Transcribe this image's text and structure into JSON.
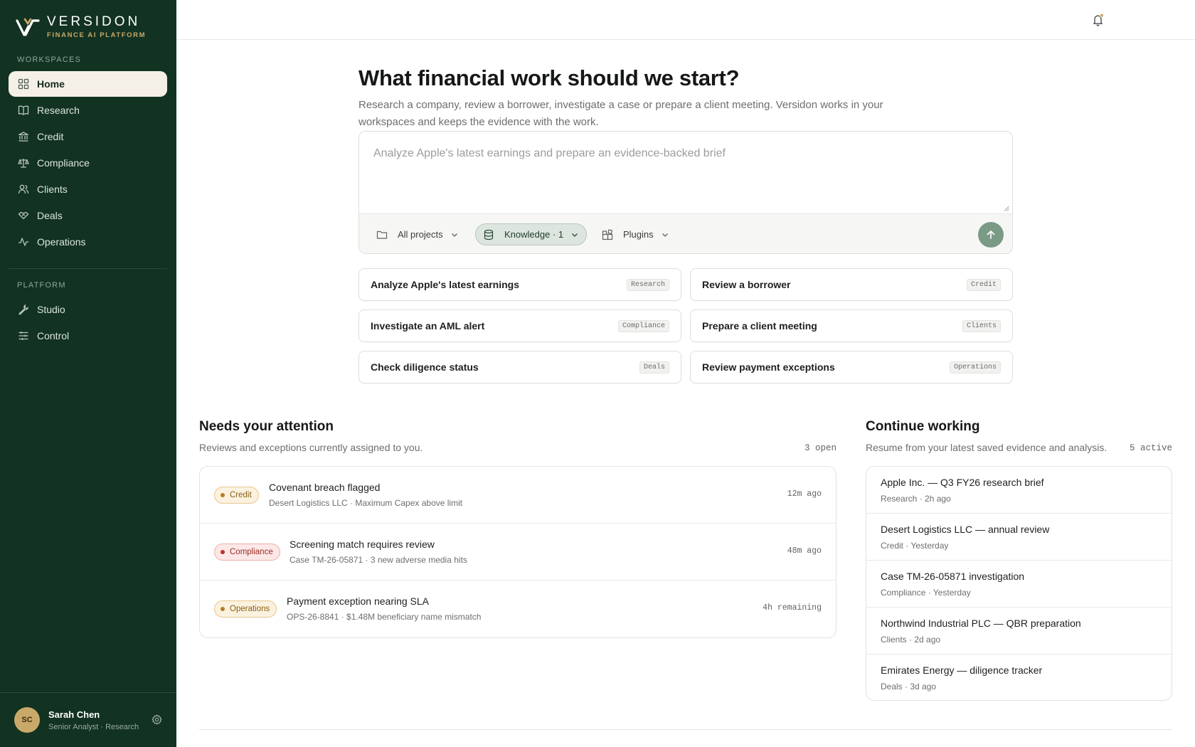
{
  "brand": {
    "name": "VERSIDON",
    "subtitle": "FINANCE AI PLATFORM"
  },
  "sidebar": {
    "workspaces_label": "WORKSPACES",
    "workspaces": [
      {
        "label": "Home",
        "icon": "grid-icon",
        "active": true
      },
      {
        "label": "Research",
        "icon": "book-icon"
      },
      {
        "label": "Credit",
        "icon": "bank-icon"
      },
      {
        "label": "Compliance",
        "icon": "scale-icon"
      },
      {
        "label": "Clients",
        "icon": "users-icon"
      },
      {
        "label": "Deals",
        "icon": "handshake-icon"
      },
      {
        "label": "Operations",
        "icon": "activity-icon"
      }
    ],
    "platform_label": "PLATFORM",
    "platform": [
      {
        "label": "Studio",
        "icon": "wrench-icon"
      },
      {
        "label": "Control",
        "icon": "sliders-icon"
      }
    ],
    "user": {
      "initials": "SC",
      "name": "Sarah Chen",
      "role": "Senior Analyst · Research"
    }
  },
  "hero": {
    "title": "What financial work should we start?",
    "subtitle": "Research a company, review a borrower, investigate a case or prepare a client meeting. Versidon works in your workspaces and keeps the evidence with the work."
  },
  "composer": {
    "placeholder": "Analyze Apple's latest earnings and prepare an evidence-backed brief",
    "value": "",
    "projects_label": "All projects",
    "knowledge_label": "Knowledge · 1",
    "plugins_label": "Plugins"
  },
  "quick_actions": [
    {
      "label": "Analyze Apple's latest earnings",
      "tag": "Research"
    },
    {
      "label": "Review a borrower",
      "tag": "Credit"
    },
    {
      "label": "Investigate an AML alert",
      "tag": "Compliance"
    },
    {
      "label": "Prepare a client meeting",
      "tag": "Clients"
    },
    {
      "label": "Check diligence status",
      "tag": "Deals"
    },
    {
      "label": "Review payment exceptions",
      "tag": "Operations"
    }
  ],
  "attention": {
    "title": "Needs your attention",
    "subtitle": "Reviews and exceptions currently assigned to you.",
    "count": "3 open",
    "items": [
      {
        "badge": "Credit",
        "title": "Covenant breach flagged",
        "meta": "Desert Logistics LLC · Maximum Capex above limit",
        "time": "12m ago"
      },
      {
        "badge": "Compliance",
        "title": "Screening match requires review",
        "meta": "Case TM-26-05871 · 3 new adverse media hits",
        "time": "48m ago"
      },
      {
        "badge": "Operations",
        "title": "Payment exception nearing SLA",
        "meta": "OPS-26-8841 · $1.48M beneficiary name mismatch",
        "time": "4h remaining"
      }
    ]
  },
  "continue": {
    "title": "Continue working",
    "subtitle": "Resume from your latest saved evidence and analysis.",
    "count": "5 active",
    "items": [
      {
        "title": "Apple Inc. — Q3 FY26 research brief",
        "meta": "Research · 2h ago"
      },
      {
        "title": "Desert Logistics LLC — annual review",
        "meta": "Credit · Yesterday"
      },
      {
        "title": "Case TM-26-05871 investigation",
        "meta": "Compliance · Yesterday"
      },
      {
        "title": "Northwind Industrial PLC — QBR preparation",
        "meta": "Clients · 2d ago"
      },
      {
        "title": "Emirates Energy — diligence tracker",
        "meta": "Deals · 3d ago"
      }
    ]
  },
  "colors": {
    "sidebar_bg": "#123222",
    "accent_gold": "#c9a96a",
    "send_button": "#7b9a86"
  }
}
